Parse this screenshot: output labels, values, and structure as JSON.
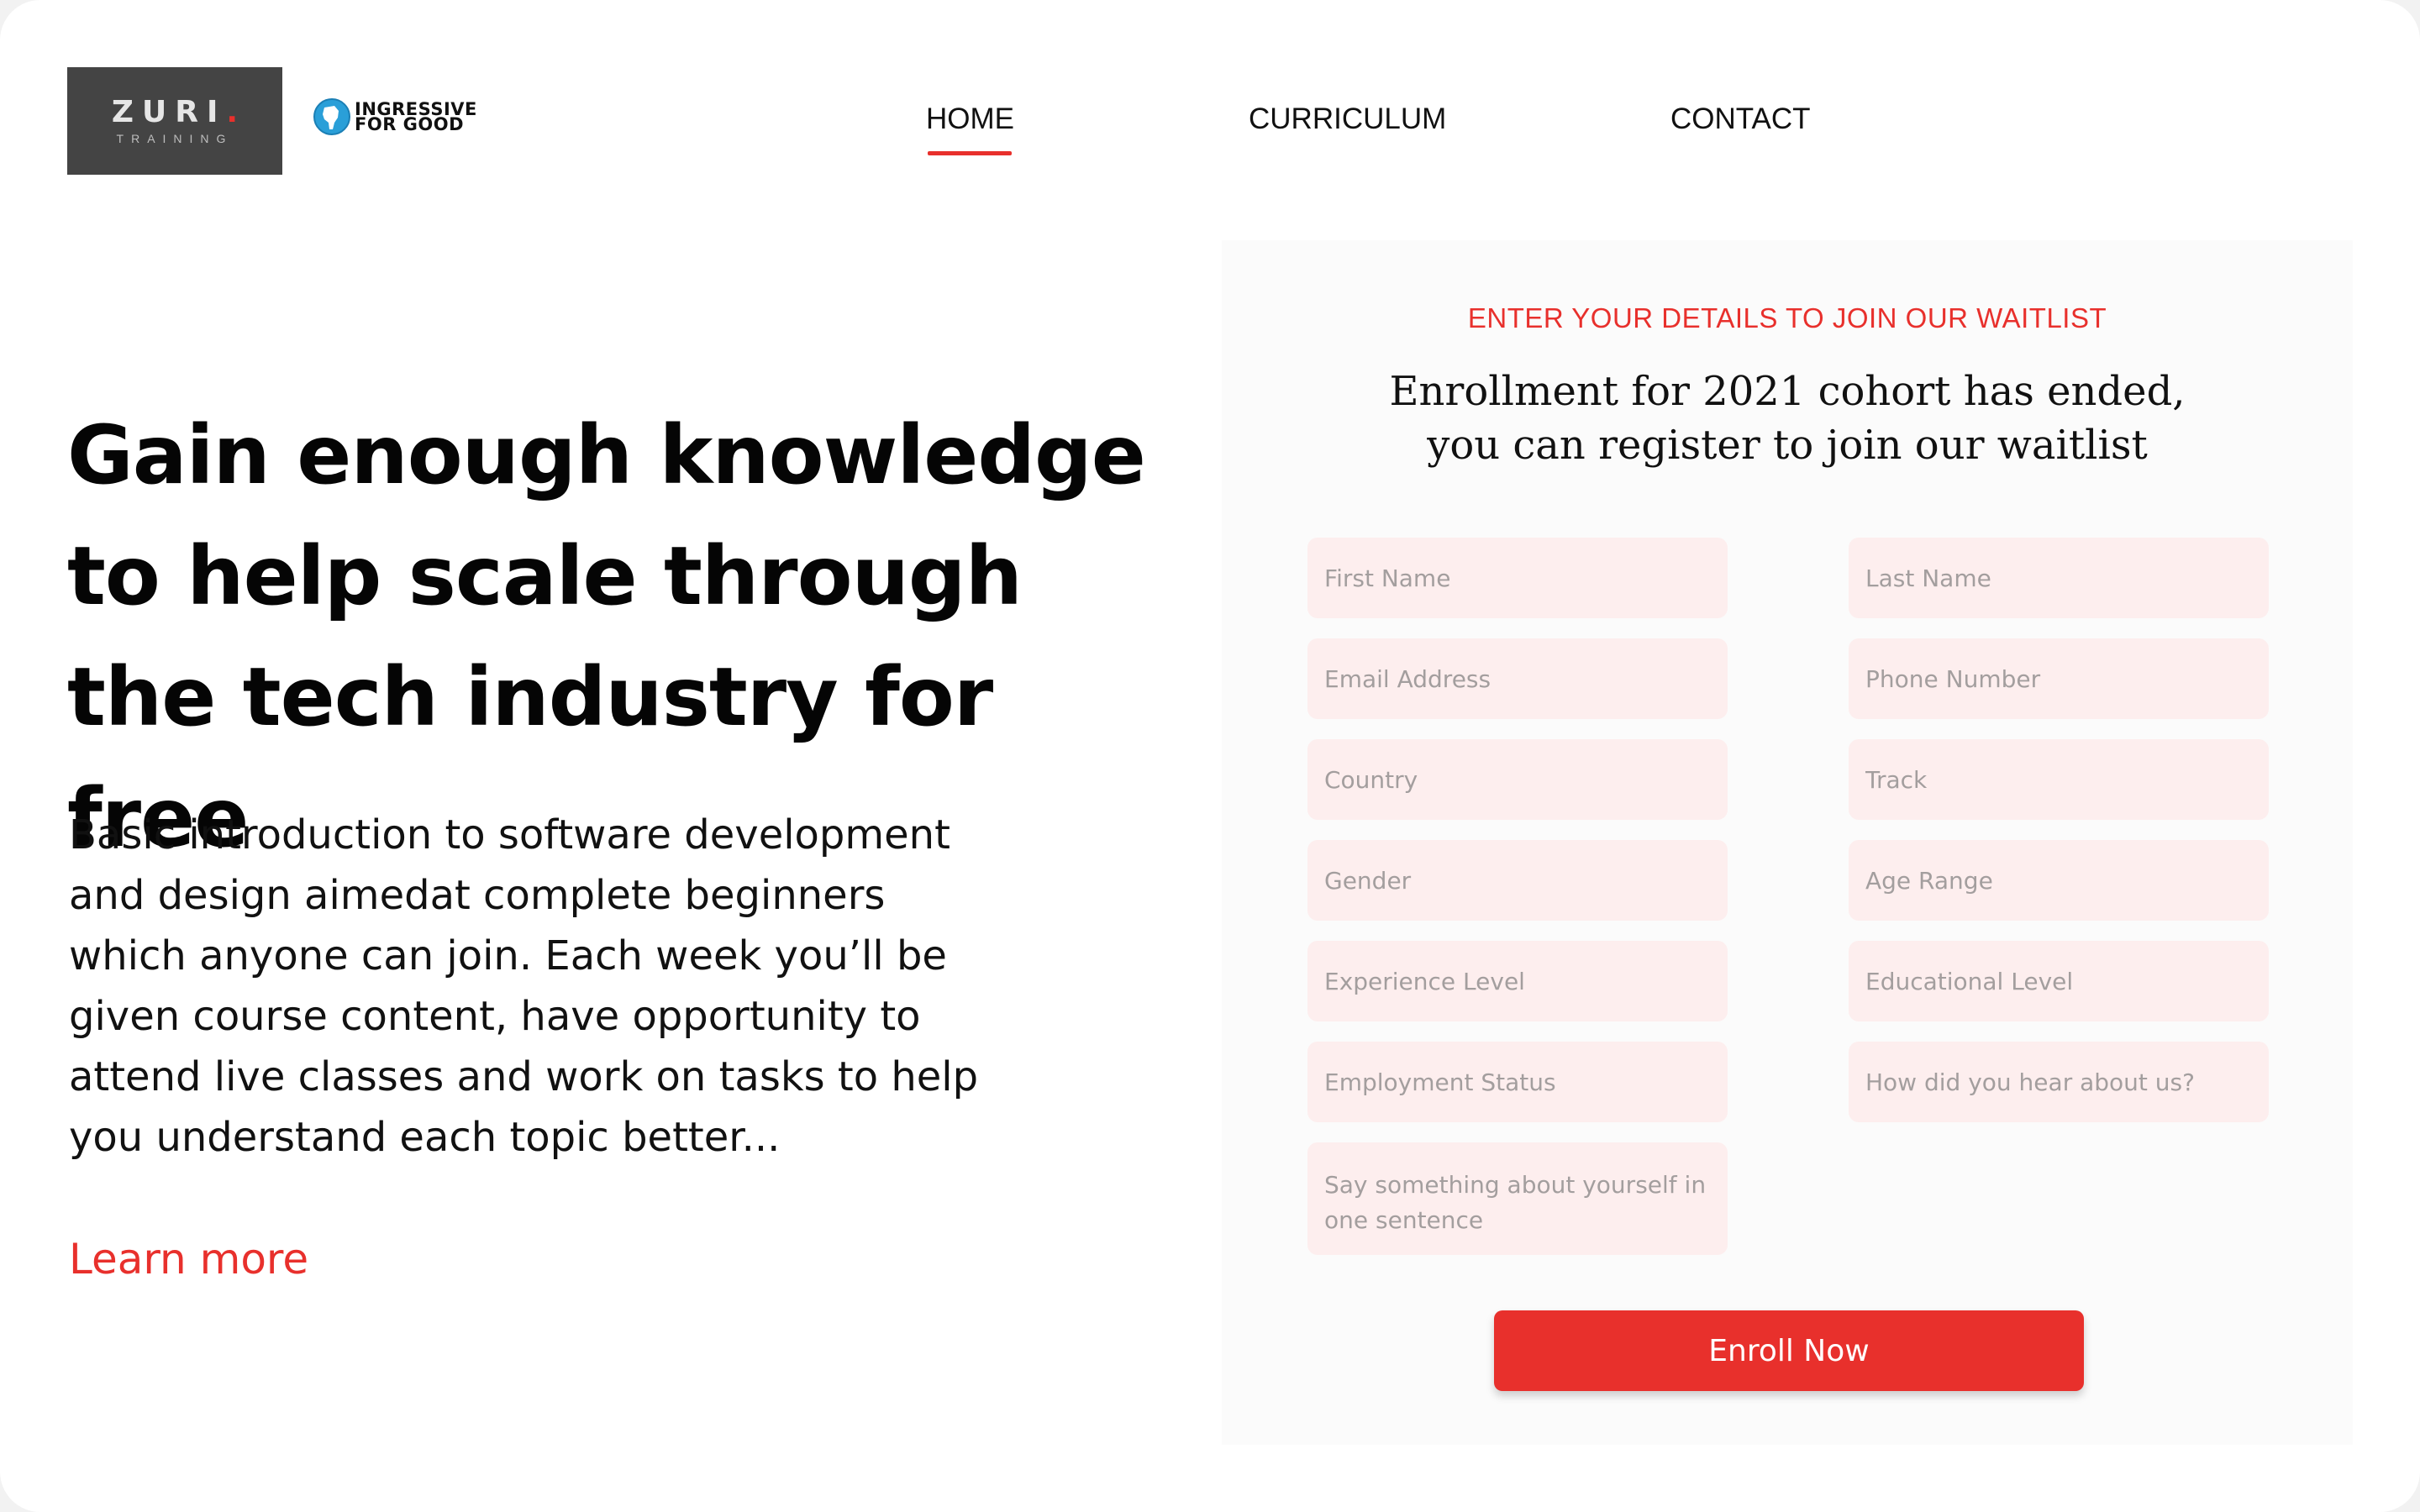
{
  "header": {
    "logo_zuri": {
      "brand": "ZURI",
      "dot": ".",
      "sub": "TRAINING"
    },
    "logo_ingressive": {
      "line1": "INGRESSIVE",
      "line2": "FOR GOOD"
    },
    "nav": {
      "home": "HOME",
      "curriculum": "CURRICULUM",
      "contact": "CONTACT",
      "active": "HOME"
    }
  },
  "hero": {
    "title": "Gain enough knowledge to help scale through the tech industry for free",
    "body": "Basic introduction to software development and design aimedat complete beginners which anyone can join. Each week you’ll be given course content, have opportunity to attend live classes and work on tasks to help you understand each topic better...",
    "learn_more": "Learn more"
  },
  "form": {
    "eyebrow": "ENTER YOUR DETAILS TO JOIN OUR WAITLIST",
    "heading_line1": "Enrollment for 2021 cohort has ended,",
    "heading_line2": "you can register to join our waitlist",
    "fields": {
      "first_name": "First Name",
      "last_name": "Last Name",
      "email": "Email Address",
      "phone": "Phone Number",
      "country": "Country",
      "track": "Track",
      "gender": "Gender",
      "age_range": "Age Range",
      "experience": "Experience Level",
      "education": "Educational Level",
      "employment": "Employment Status",
      "referral": "How did you hear about us?",
      "about": "Say something about yourself in one sentence"
    },
    "submit": "Enroll Now"
  },
  "colors": {
    "accent": "#e8302c",
    "field_bg": "#fdeeee",
    "logo_bg": "#444444",
    "panel_bg": "#fbfbfb"
  },
  "icons": {
    "globe": "africa-globe-icon"
  }
}
